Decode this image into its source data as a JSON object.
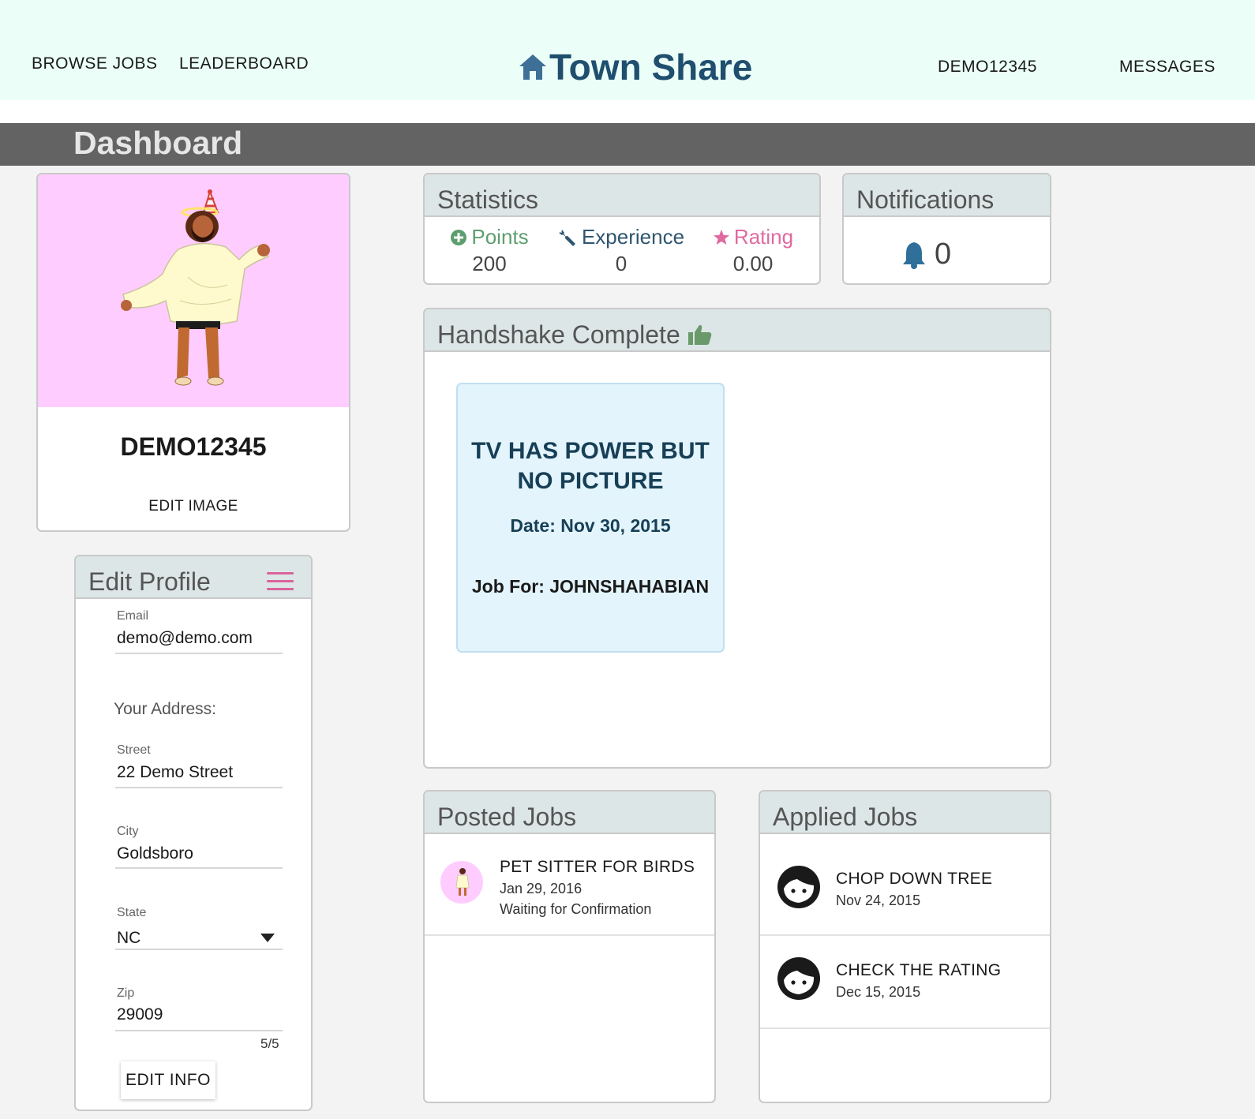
{
  "nav": {
    "browse_jobs": "BROWSE JOBS",
    "leaderboard": "LEADERBOARD",
    "brand": "Town Share",
    "username": "DEMO12345",
    "messages": "MESSAGES"
  },
  "dashboard": {
    "title": "Dashboard"
  },
  "profile": {
    "name": "DEMO12345",
    "edit_image": "EDIT IMAGE"
  },
  "edit_profile": {
    "title": "Edit Profile",
    "email_label": "Email",
    "email": "demo@demo.com",
    "address_heading": "Your Address:",
    "street_label": "Street",
    "street": "22 Demo Street",
    "city_label": "City",
    "city": "Goldsboro",
    "state_label": "State",
    "state": "NC",
    "zip_label": "Zip",
    "zip": "29009",
    "zip_counter": "5/5",
    "edit_info": "EDIT INFO"
  },
  "statistics": {
    "title": "Statistics",
    "points_label": "Points",
    "points": "200",
    "experience_label": "Experience",
    "experience": "0",
    "rating_label": "Rating",
    "rating": "0.00"
  },
  "notifications": {
    "title": "Notifications",
    "count": "0"
  },
  "handshake": {
    "title": "Handshake Complete",
    "job_title": "TV HAS POWER BUT NO PICTURE",
    "job_date": "Date: Nov 30, 2015",
    "job_for": "Job For: JOHNSHAHABIAN"
  },
  "posted_jobs": {
    "title": "Posted Jobs",
    "items": [
      {
        "title": "PET SITTER FOR BIRDS",
        "date": "Jan 29, 2016",
        "status": "Waiting for Confirmation"
      }
    ]
  },
  "applied_jobs": {
    "title": "Applied Jobs",
    "items": [
      {
        "title": "CHOP DOWN TREE",
        "date": "Nov 24, 2015"
      },
      {
        "title": "CHECK THE RATING",
        "date": "Dec 15, 2015"
      }
    ]
  },
  "colors": {
    "header_bg": "#ebfff8",
    "brand": "#1f4e6e",
    "dashboard_bar": "#636363",
    "points": "#5e9e6e",
    "experience": "#2f5670",
    "rating": "#e06aa0",
    "profile_bg": "#ffccff",
    "tile_bg": "#e3f4fc"
  },
  "icons": {
    "brand": "home-icon",
    "points": "plus-circle-icon",
    "experience": "wrench-icon",
    "rating": "star-icon",
    "notifications": "bell-icon",
    "handshake": "thumbs-up-icon",
    "menu": "hamburger-icon",
    "applied_job": "face-avatar-icon"
  }
}
